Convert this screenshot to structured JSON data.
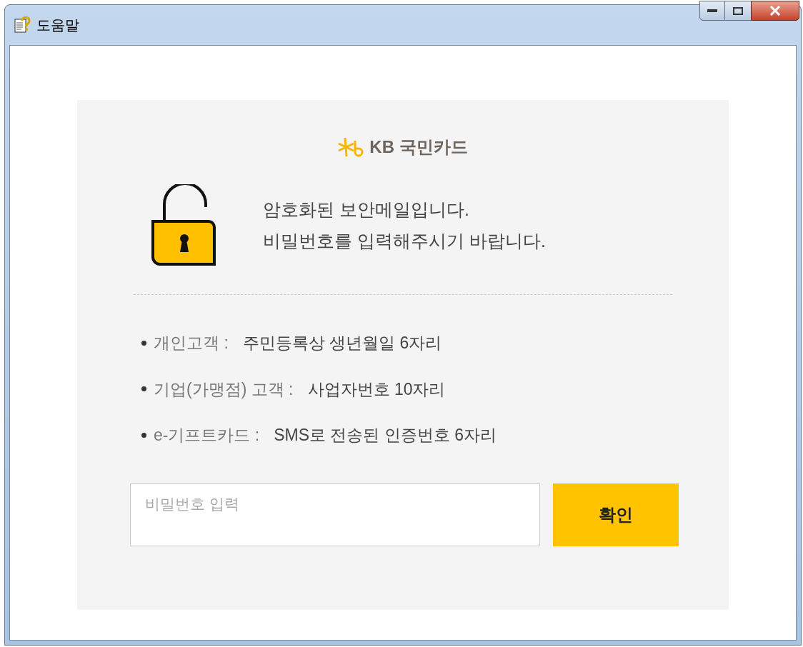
{
  "window": {
    "title": "도움말"
  },
  "logo": {
    "text": "KB 국민카드"
  },
  "message": [
    "암호화된 보안메일입니다.",
    "비밀번호를 입력해주시기 바랍니다."
  ],
  "info": [
    {
      "label": "개인고객 :",
      "value": "주민등록상 생년월일 6자리"
    },
    {
      "label": "기업(가맹점) 고객 :",
      "value": "사업자번호 10자리"
    },
    {
      "label": "e-기프트카드 :",
      "value": "SMS로 전송된 인증번호 6자리"
    }
  ],
  "password": {
    "placeholder": "비밀번호 입력"
  },
  "confirm_button": "확인"
}
